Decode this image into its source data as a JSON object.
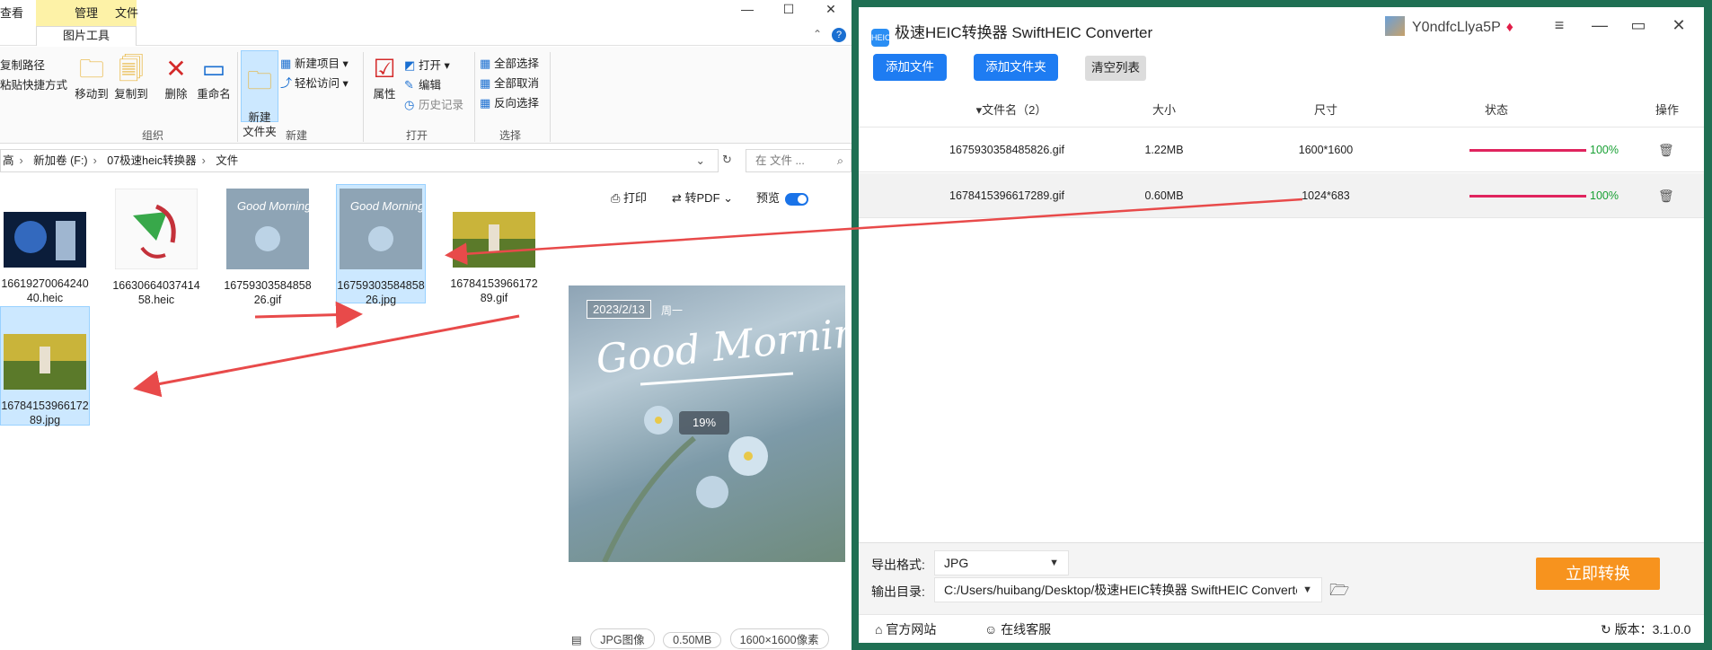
{
  "explorer": {
    "tabs": {
      "view": "查看",
      "manage": "管理",
      "file": "文件",
      "picture_tools": "图片工具"
    },
    "ribbon": {
      "copy_path": "复制路径",
      "paste_shortcut": "粘贴快捷方式",
      "move_to": "移动到",
      "copy_to": "复制到",
      "delete": "删除",
      "rename": "重命名",
      "new_folder": "新建\n文件夹",
      "new_item": "新建项目",
      "easy_access": "轻松访问",
      "properties": "属性",
      "open": "打开",
      "edit": "编辑",
      "history": "历史记录",
      "select_all": "全部选择",
      "select_none": "全部取消",
      "invert_selection": "反向选择",
      "group_organize": "组织",
      "group_new": "新建",
      "group_open": "打开",
      "group_select": "选择"
    },
    "breadcrumb": [
      "新加卷 (F:)",
      "07极速heic转换器",
      "文件"
    ],
    "breadcrumb_prefix": "高",
    "search_placeholder": "在 文件 ...",
    "files": [
      {
        "name": "1661927006424040.heic"
      },
      {
        "name": "1663066403741458.heic"
      },
      {
        "name": "1675930358485826.gif"
      },
      {
        "name": "1675930358485826.jpg"
      },
      {
        "name": "1678415396617289.gif"
      },
      {
        "name": "1678415396617289.jpg"
      }
    ],
    "preview_toolbar": {
      "print": "打印",
      "to_pdf": "转PDF",
      "preview": "预览"
    },
    "preview": {
      "date": "2023/2/13",
      "weekday": "周一",
      "headline": "Good Morning!",
      "progress": "19%"
    },
    "status": {
      "type": "JPG图像",
      "size": "0.50MB",
      "dimensions": "1600×1600像素"
    }
  },
  "converter": {
    "title": "极速HEIC转换器 SwiftHEIC Converter",
    "logo_text": "HEIC",
    "user": "Y0ndfcLlya5P",
    "buttons": {
      "add_file": "添加文件",
      "add_folder": "添加文件夹",
      "clear_list": "清空列表"
    },
    "columns": {
      "filename": "文件名（2）",
      "size": "大小",
      "dimensions": "尺寸",
      "status": "状态",
      "action": "操作"
    },
    "rows": [
      {
        "name": "1675930358485826.gif",
        "size": "1.22MB",
        "dimensions": "1600*1600",
        "progress": "100%"
      },
      {
        "name": "1678415396617289.gif",
        "size": "0.60MB",
        "dimensions": "1024*683",
        "progress": "100%"
      }
    ],
    "export_format_label": "导出格式:",
    "export_format": "JPG",
    "output_dir_label": "输出目录:",
    "output_dir": "C:/Users/huibang/Desktop/极速HEIC转换器 SwiftHEIC Converter",
    "convert_button": "立即转换",
    "website": "官方网站",
    "support": "在线客服",
    "version": "版本：3.1.0.0"
  },
  "colors": {
    "accent": "#1e7cf2",
    "convert": "#f7931e",
    "progress": "#e0245e",
    "done": "#18a034",
    "selection": "#cce8ff",
    "arrow": "#e84a4a"
  }
}
